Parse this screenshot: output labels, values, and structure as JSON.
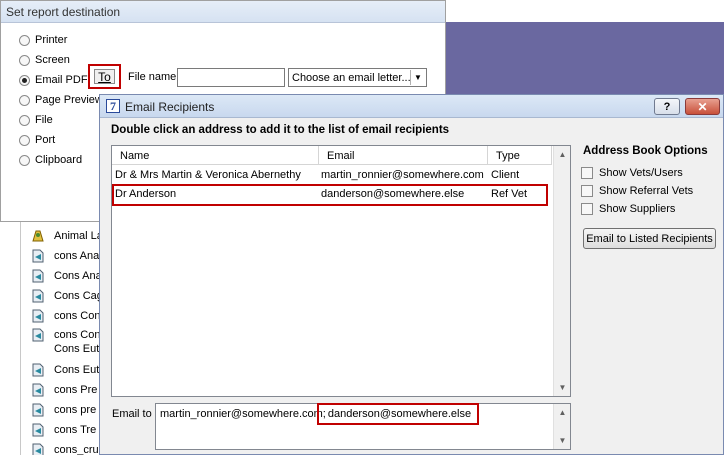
{
  "report_destination": {
    "title": "Set report destination",
    "options": [
      {
        "label": "Printer",
        "checked": false
      },
      {
        "label": "Screen",
        "checked": false
      },
      {
        "label": "Email PDF",
        "checked": true
      },
      {
        "label": "Page Preview",
        "checked": false
      },
      {
        "label": "File",
        "checked": false
      },
      {
        "label": "Port",
        "checked": false
      },
      {
        "label": "Clipboard",
        "checked": false
      }
    ],
    "to_button_label": "To",
    "file_name_label": "File name",
    "file_name_value": "",
    "email_letter_select": "Choose an email letter..."
  },
  "background_list": {
    "items": [
      {
        "label": "Animal La",
        "icon": "animal-icon"
      },
      {
        "label": "cons Ana",
        "icon": "doc-icon"
      },
      {
        "label": "Cons Ana",
        "icon": "doc-icon"
      },
      {
        "label": "Cons Cag",
        "icon": "doc-icon"
      },
      {
        "label": "cons Con",
        "icon": "doc-icon"
      },
      {
        "label": "cons Con",
        "icon": "doc-icon"
      },
      {
        "label": "Cons Eut",
        "icon": "doc-icon"
      },
      {
        "label": "Cons Eut",
        "icon": "doc-icon"
      },
      {
        "label": "cons Pre",
        "icon": "doc-icon"
      },
      {
        "label": "cons pre",
        "icon": "doc-icon"
      },
      {
        "label": "cons Tre",
        "icon": "doc-icon"
      },
      {
        "label": "cons_cru",
        "icon": "doc-icon"
      }
    ]
  },
  "email_recipients": {
    "title": "Email Recipients",
    "help_label": "?",
    "close_label": "✕",
    "instruction": "Double click an address to add it to the list of email recipients",
    "columns": [
      "Name",
      "Email",
      "Type"
    ],
    "rows": [
      {
        "name": "Dr & Mrs Martin & Veronica Abernethy",
        "email": "martin_ronnier@somewhere.com",
        "type": "Client"
      },
      {
        "name": "Dr Anderson",
        "email": "danderson@somewhere.else",
        "type": "Ref Vet"
      }
    ],
    "address_book": {
      "title": "Address Book Options",
      "options": [
        "Show Vets/Users",
        "Show Referral Vets",
        "Show Suppliers"
      ],
      "button_label": "Email to Listed Recipients"
    },
    "email_to_label": "Email to",
    "email_to_first": "martin_ronnier@somewhere.com;",
    "email_to_second": "danderson@somewhere.else"
  },
  "colors": {
    "highlight": "#c00000",
    "desktop_purple": "#6a68a0"
  }
}
